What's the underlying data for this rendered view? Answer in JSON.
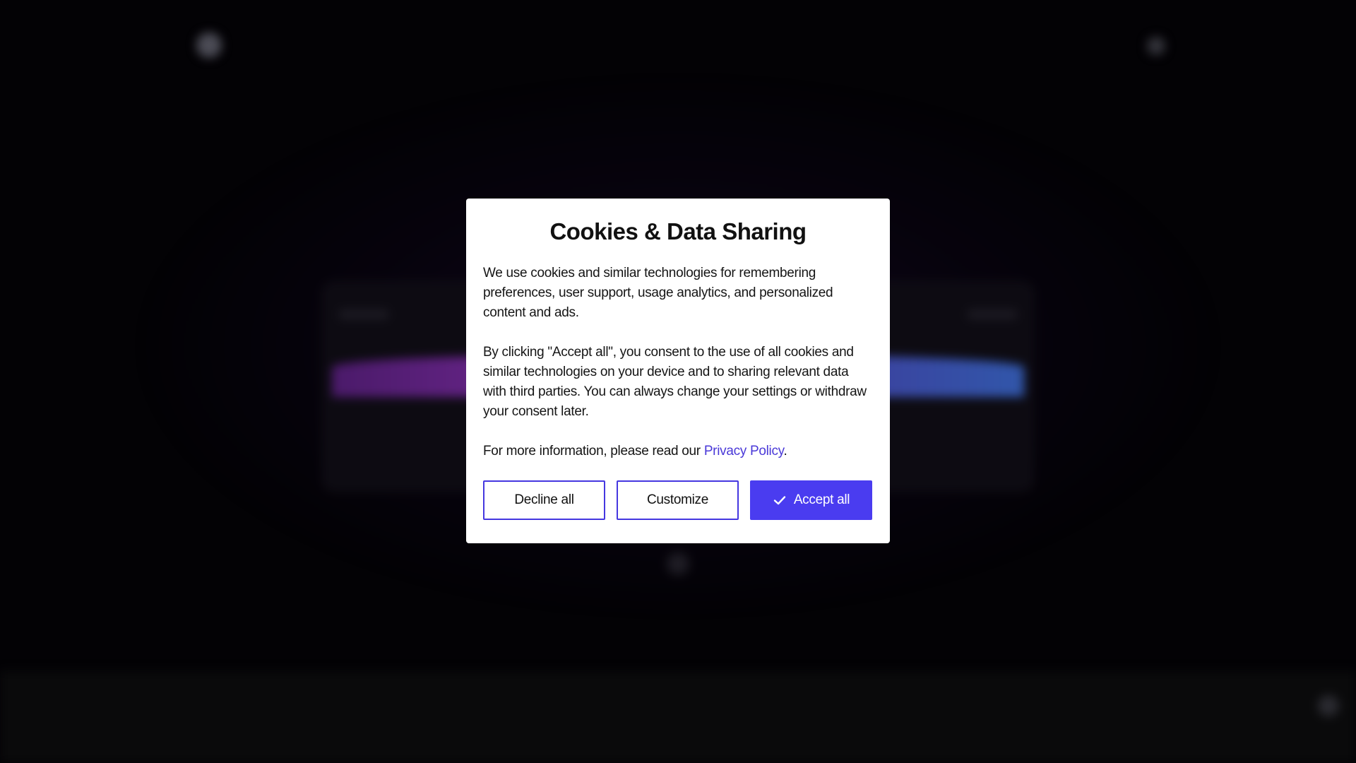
{
  "background": {
    "brand_line1": "",
    "brand_line2": "",
    "nav_label": "",
    "hero_title": "",
    "footer_title": ""
  },
  "modal": {
    "title": "Cookies & Data Sharing",
    "paragraph1": "We use cookies and similar technologies for remembering preferences, user support, usage analytics, and personalized content and ads.",
    "paragraph2": "By clicking \"Accept all\", you consent to the use of all cookies and similar technologies on your device and to sharing relevant data with third parties. You can always change your settings or withdraw your consent later.",
    "paragraph3_prefix": "For more information, please read our ",
    "privacy_link": "Privacy Policy",
    "paragraph3_suffix": ".",
    "buttons": {
      "decline": "Decline all",
      "customize": "Customize",
      "accept": "Accept all"
    }
  },
  "colors": {
    "accent": "#4a3cf0",
    "link": "#4a39d8",
    "modal_bg": "#ffffff",
    "overlay_bg": "#030205"
  },
  "icons": {
    "accept_icon": "check-icon"
  }
}
